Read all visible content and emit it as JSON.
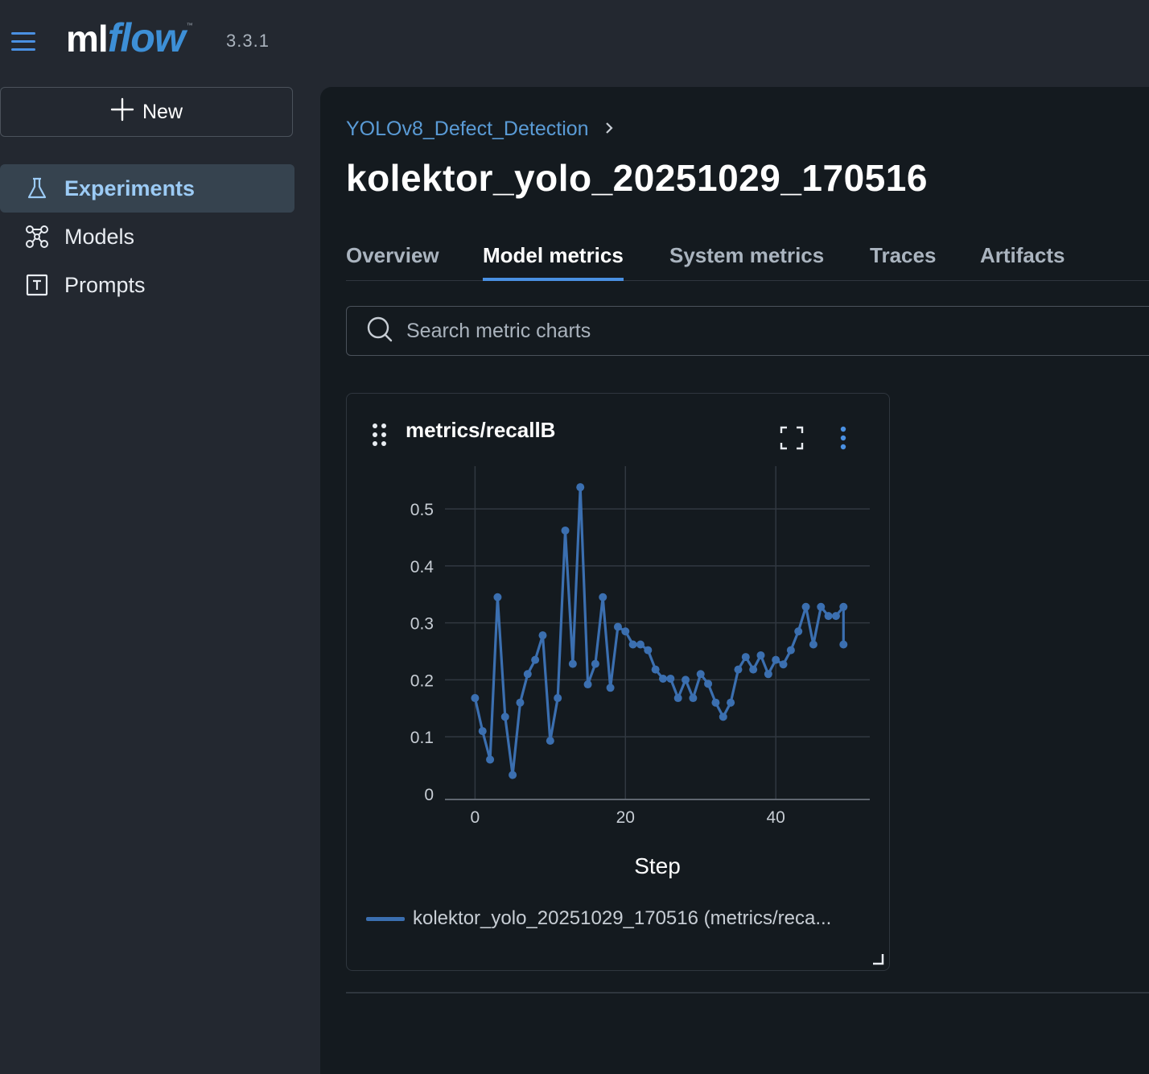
{
  "app": {
    "logo_ml": "ml",
    "logo_flow": "flow",
    "logo_tm": "™",
    "version": "3.3.1"
  },
  "sidebar": {
    "new_label": "New",
    "items": [
      {
        "label": "Experiments",
        "icon": "flask-icon",
        "active": true
      },
      {
        "label": "Models",
        "icon": "models-icon",
        "active": false
      },
      {
        "label": "Prompts",
        "icon": "prompt-icon",
        "active": false
      }
    ]
  },
  "main": {
    "breadcrumb": "YOLOv8_Defect_Detection",
    "title": "kolektor_yolo_20251029_170516",
    "tabs": [
      "Overview",
      "Model metrics",
      "System metrics",
      "Traces",
      "Artifacts"
    ],
    "active_tab": "Model metrics",
    "search_placeholder": "Search metric charts"
  },
  "card": {
    "title": "metrics/recallB",
    "legend": "kolektor_yolo_20251029_170516 (metrics/reca..."
  },
  "colors": {
    "accent": "#4a90e2",
    "series": "#3b6fb0",
    "background": "#232830",
    "panel": "#141a1f"
  },
  "chart_data": {
    "type": "line",
    "xlabel": "Step",
    "ylabel": "",
    "xlim": [
      -4,
      52.5
    ],
    "ylim": [
      -0.01,
      0.575
    ],
    "xticks": [
      0,
      20,
      40
    ],
    "yticks": [
      0,
      0.1,
      0.2,
      0.3,
      0.4,
      0.5
    ],
    "ytick_labels": [
      "0",
      "0.1",
      "0.2",
      "0.3",
      "0.4",
      "0.5"
    ],
    "grid": true,
    "series": [
      {
        "name": "kolektor_yolo_20251029_170516 (metrics/reca...",
        "color": "#3b6fb0",
        "x": [
          0,
          1,
          2,
          3,
          4,
          5,
          6,
          7,
          8,
          9,
          10,
          11,
          12,
          13,
          14,
          15,
          16,
          17,
          18,
          19,
          20,
          21,
          22,
          23,
          24,
          25,
          26,
          27,
          28,
          29,
          30,
          31,
          32,
          33,
          34,
          35,
          36,
          37,
          38,
          39,
          40,
          41,
          42,
          43,
          44,
          45,
          46,
          47,
          48,
          49,
          49
        ],
        "y": [
          0.168,
          0.11,
          0.06,
          0.345,
          0.135,
          0.033,
          0.16,
          0.21,
          0.235,
          0.278,
          0.093,
          0.168,
          0.462,
          0.228,
          0.538,
          0.192,
          0.228,
          0.345,
          0.186,
          0.293,
          0.285,
          0.262,
          0.262,
          0.252,
          0.218,
          0.202,
          0.202,
          0.168,
          0.2,
          0.168,
          0.21,
          0.193,
          0.16,
          0.135,
          0.16,
          0.218,
          0.24,
          0.218,
          0.243,
          0.21,
          0.235,
          0.227,
          0.252,
          0.285,
          0.328,
          0.262,
          0.328,
          0.312,
          0.312,
          0.328,
          0.262
        ]
      }
    ]
  }
}
